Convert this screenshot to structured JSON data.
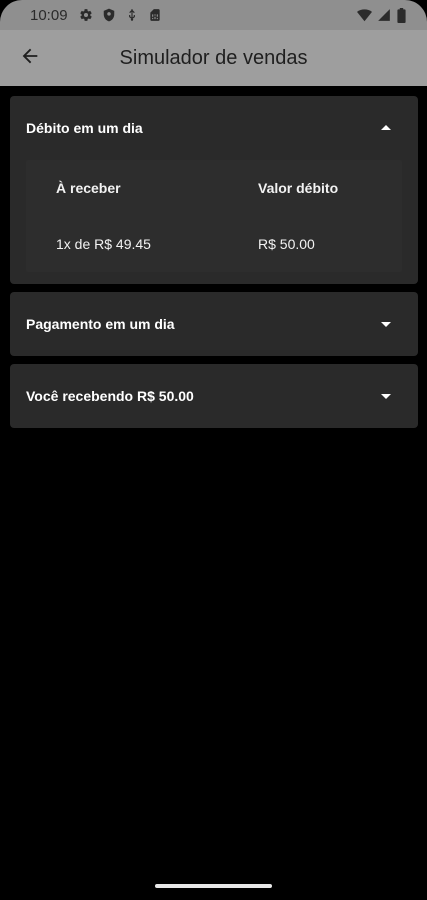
{
  "status_bar": {
    "time": "10:09",
    "left_icons": [
      "gear-icon",
      "shield-icon",
      "usb-icon",
      "sim-card-icon"
    ],
    "right_icons": [
      "wifi-icon",
      "cell-signal-icon",
      "battery-icon"
    ]
  },
  "app_bar": {
    "title": "Simulador de vendas",
    "back_icon": "arrow-left-icon"
  },
  "panels": [
    {
      "title": "Débito em um dia",
      "expanded": true,
      "chevron": "chevron-up-icon",
      "table": {
        "headers": [
          "À receber",
          "Valor débito"
        ],
        "rows": [
          [
            "1x de R$ 49.45",
            "R$ 50.00"
          ]
        ]
      }
    },
    {
      "title": "Pagamento em um dia",
      "expanded": false,
      "chevron": "chevron-down-icon"
    },
    {
      "title": "Você recebendo R$ 50.00",
      "expanded": false,
      "chevron": "chevron-down-icon"
    }
  ],
  "colors": {
    "background": "#000000",
    "app_bar": "#9e9e9e",
    "status_bar": "#8f8f8f",
    "panel": "#2a2a2a",
    "text": "#ffffff"
  }
}
